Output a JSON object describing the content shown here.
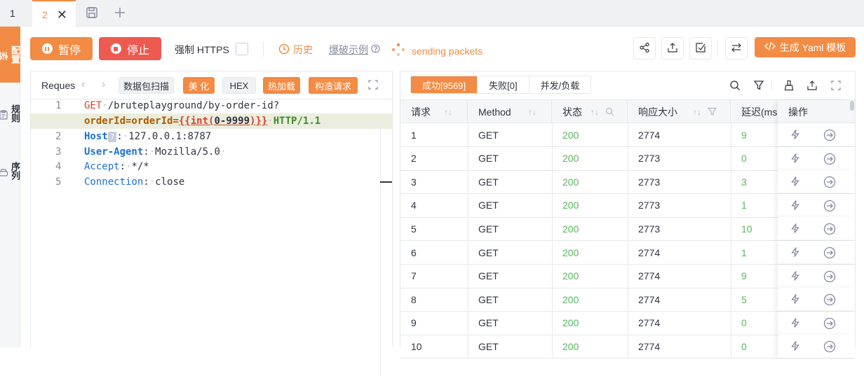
{
  "tabs": {
    "tab1_label": "1",
    "tab2_label": "2"
  },
  "rail": {
    "items": [
      {
        "label": "配置",
        "icon": "sliders-icon"
      },
      {
        "label": "规则",
        "icon": "clipboard-icon"
      },
      {
        "label": "序列",
        "icon": "stack-icon"
      }
    ]
  },
  "toolbar": {
    "pause_label": "暂停",
    "stop_label": "停止",
    "https_label": "强制 HTTPS",
    "history_label": "历史",
    "example_label": "爆破示例",
    "sending_label": "sending packets",
    "yaml_label": "生成 Yaml 模板"
  },
  "request": {
    "title": "Reques",
    "buttons": {
      "scan": "数据包扫描",
      "beautify": "美 化",
      "hex": "HEX",
      "hotload": "热加载",
      "construct": "构造请求"
    },
    "lines": [
      {
        "num": "1",
        "method": "GET",
        "path": "/bruteplayground/by-order-id?"
      },
      {
        "num": "",
        "param": "orderId=orderId=",
        "fuzz_open": "{{int(",
        "fuzz_range": "0-9999",
        "fuzz_close": ")}}",
        "http": "HTTP/1.1"
      },
      {
        "num": "2",
        "key": "Host",
        "value": "127.0.0.1:8787"
      },
      {
        "num": "3",
        "key": "User-Agent",
        "value": "Mozilla/5.0"
      },
      {
        "num": "4",
        "key": "Accept",
        "value": "*/*"
      },
      {
        "num": "5",
        "key": "Connection",
        "value": "close"
      }
    ],
    "host_badge": "?"
  },
  "results": {
    "tabs": [
      "成功[9569]",
      "失败[0]",
      "并发/负载"
    ],
    "columns": [
      "请求",
      "Method",
      "状态",
      "响应大小",
      "延迟(ms",
      "操作"
    ],
    "rows": [
      {
        "id": "1",
        "method": "GET",
        "status": "200",
        "size": "2774",
        "delay": "9"
      },
      {
        "id": "2",
        "method": "GET",
        "status": "200",
        "size": "2773",
        "delay": "0"
      },
      {
        "id": "3",
        "method": "GET",
        "status": "200",
        "size": "2773",
        "delay": "3"
      },
      {
        "id": "4",
        "method": "GET",
        "status": "200",
        "size": "2773",
        "delay": "1"
      },
      {
        "id": "5",
        "method": "GET",
        "status": "200",
        "size": "2773",
        "delay": "10"
      },
      {
        "id": "6",
        "method": "GET",
        "status": "200",
        "size": "2774",
        "delay": "1"
      },
      {
        "id": "7",
        "method": "GET",
        "status": "200",
        "size": "2774",
        "delay": "9"
      },
      {
        "id": "8",
        "method": "GET",
        "status": "200",
        "size": "2774",
        "delay": "5"
      },
      {
        "id": "9",
        "method": "GET",
        "status": "200",
        "size": "2774",
        "delay": "0"
      },
      {
        "id": "10",
        "method": "GET",
        "status": "200",
        "size": "2774",
        "delay": "0"
      }
    ]
  },
  "colors": {
    "accent": "#f28b44",
    "stop": "#ed5a4f",
    "status_ok": "#56b85a"
  }
}
